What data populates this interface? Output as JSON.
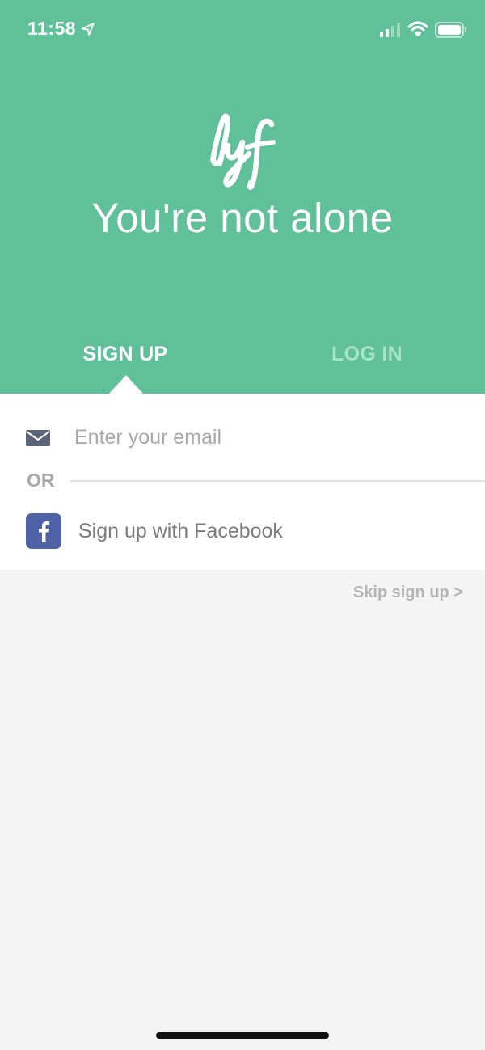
{
  "status_bar": {
    "time": "11:58",
    "location_icon": "location-arrow-icon",
    "signal_icon": "cellular-signal-icon",
    "wifi_icon": "wifi-icon",
    "battery_icon": "battery-icon"
  },
  "hero": {
    "logo_text": "lyf",
    "tagline": "You're not alone",
    "background_color": "#5fc09a"
  },
  "tabs": [
    {
      "label": "SIGN UP",
      "active": true
    },
    {
      "label": "LOG IN",
      "active": false
    }
  ],
  "form": {
    "email_placeholder": "Enter your email",
    "email_value": "",
    "email_icon": "mail-icon",
    "or_label": "OR",
    "facebook_label": "Sign up with Facebook",
    "facebook_icon": "facebook-icon",
    "facebook_color": "#4f62a6"
  },
  "skip": {
    "label": "Skip sign up >"
  }
}
